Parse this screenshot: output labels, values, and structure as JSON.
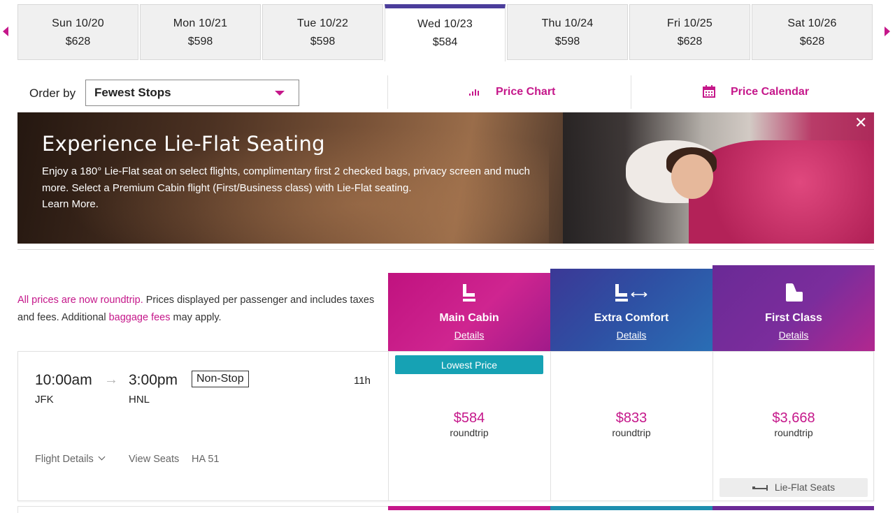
{
  "dates": [
    {
      "day": "Sun 10/20",
      "price": "$628",
      "active": false
    },
    {
      "day": "Mon 10/21",
      "price": "$598",
      "active": false
    },
    {
      "day": "Tue 10/22",
      "price": "$598",
      "active": false
    },
    {
      "day": "Wed 10/23",
      "price": "$584",
      "active": true
    },
    {
      "day": "Thu 10/24",
      "price": "$598",
      "active": false
    },
    {
      "day": "Fri 10/25",
      "price": "$628",
      "active": false
    },
    {
      "day": "Sat 10/26",
      "price": "$628",
      "active": false
    }
  ],
  "order": {
    "label": "Order by",
    "selected": "Fewest Stops"
  },
  "tools": {
    "price_chart": "Price Chart",
    "price_calendar": "Price Calendar"
  },
  "banner": {
    "title": "Experience Lie-Flat Seating",
    "body": "Enjoy a 180° Lie-Flat seat on select flights, complimentary first 2 checked bags, privacy screen and much more. Select a Premium Cabin flight (First/Business class) with Lie-Flat seating.",
    "learn_more": "Learn More.",
    "close": "✕"
  },
  "info": {
    "roundtrip_link": "All prices are now roundtrip.",
    "text1": " Prices displayed per passenger and includes taxes and fees. Additional ",
    "baggage_link": "baggage fees",
    "text2": " may apply."
  },
  "cabins": [
    {
      "name": "Main Cabin",
      "details": "Details",
      "icon": "seat-icon"
    },
    {
      "name": "Extra Comfort",
      "details": "Details",
      "icon": "seat-legroom-icon"
    },
    {
      "name": "First Class",
      "details": "Details",
      "icon": "premium-seat-icon"
    }
  ],
  "flight": {
    "depart_time": "10:00am",
    "arrive_time": "3:00pm",
    "depart_code": "JFK",
    "arrive_code": "HNL",
    "stops": "Non-Stop",
    "duration": "11h",
    "details_link": "Flight Details",
    "view_seats": "View Seats",
    "flight_no": "HA 51",
    "lowest_badge": "Lowest Price",
    "prices": [
      {
        "amount": "$584",
        "label": "roundtrip"
      },
      {
        "amount": "$833",
        "label": "roundtrip"
      },
      {
        "amount": "$3,668",
        "label": "roundtrip"
      }
    ],
    "lieflat": "Lie-Flat Seats"
  },
  "colors": {
    "accent": "#c5178a",
    "active_tab": "#4b3d9b",
    "lowest_badge": "#16a2b4"
  }
}
